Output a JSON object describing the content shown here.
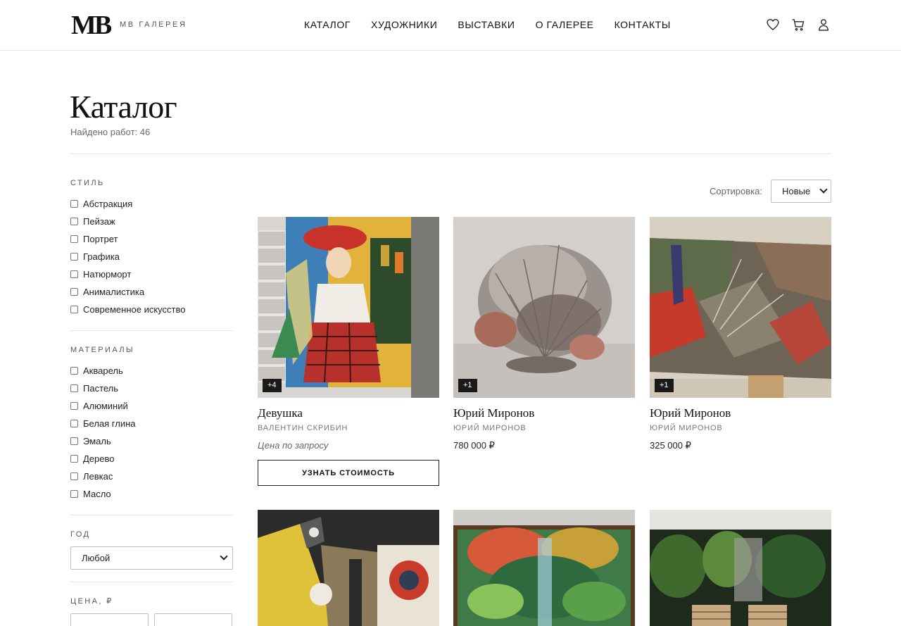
{
  "header": {
    "logo_mark": "MB",
    "logo_text": "MB ГАЛЕРЕЯ",
    "nav": [
      "КАТАЛОГ",
      "ХУДОЖНИКИ",
      "ВЫСТАВКИ",
      "О ГАЛЕРЕЕ",
      "КОНТАКТЫ"
    ],
    "icons": [
      "heart-icon",
      "cart-icon",
      "user-icon"
    ]
  },
  "page": {
    "title": "Каталог",
    "found": "Найдено работ: 46"
  },
  "filters": {
    "style": {
      "heading": "СТИЛЬ",
      "options": [
        "Абстракция",
        "Пейзаж",
        "Портрет",
        "Графика",
        "Натюрморт",
        "Анималистика",
        "Современное искусство"
      ]
    },
    "materials": {
      "heading": "МАТЕРИАЛЫ",
      "options": [
        "Акварель",
        "Пастель",
        "Алюминий",
        "Белая глина",
        "Эмаль",
        "Дерево",
        "Левкас",
        "Масло"
      ]
    },
    "year": {
      "heading": "ГОД",
      "selected": "Любой"
    },
    "price": {
      "heading": "ЦЕНА, ₽"
    }
  },
  "sort": {
    "label": "Сортировка:",
    "selected": "Новые"
  },
  "cards": [
    {
      "badge": "+4",
      "title": "Девушка",
      "artist": "ВАЛЕНТИН СКРИБИН",
      "price": "Цена по запросу",
      "button": "УЗНАТЬ СТОИМОСТЬ"
    },
    {
      "badge": "+1",
      "title": "Юрий Миронов",
      "artist": "ЮРИЙ МИРОНОВ",
      "price": "780 000 ₽"
    },
    {
      "badge": "+1",
      "title": "Юрий Миронов",
      "artist": "ЮРИЙ МИРОНОВ",
      "price": "325 000 ₽"
    }
  ],
  "colors": {
    "text": "#111111",
    "muted": "#777777",
    "border": "#e5e5e5",
    "badge_bg": "#1a1a1a"
  }
}
